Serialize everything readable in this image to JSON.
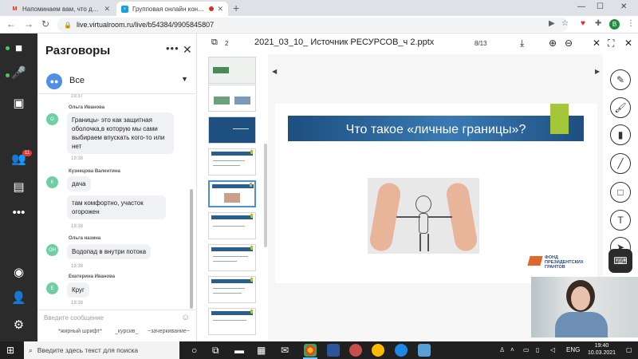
{
  "browser": {
    "tabs": [
      {
        "icon": "gmail-icon",
        "label": "Напоминаем вам, что до начал",
        "favicon_color": "#d93025"
      },
      {
        "icon": "virtualroom-icon",
        "label": "Групповая онлайн консульт",
        "favicon_color": "#1a9dd9",
        "recording": true
      }
    ],
    "url": "live.virtualroom.ru/live/b54384/9905845807",
    "profile_initial": "В"
  },
  "rail": {
    "items": [
      {
        "icon": "camera-icon"
      },
      {
        "icon": "microphone-icon"
      },
      {
        "icon": "contacts-icon"
      },
      {
        "icon": "participants-icon",
        "badge": "11"
      },
      {
        "icon": "chat-icon"
      },
      {
        "icon": "more-icon"
      },
      {
        "icon": "record-icon"
      },
      {
        "icon": "add-user-icon"
      },
      {
        "icon": "settings-icon"
      }
    ]
  },
  "chat": {
    "title": "Разговоры",
    "filter": "Все",
    "first_time": "19:37",
    "messages": [
      {
        "sender": "Ольга Иванова",
        "initials": "О",
        "text": "Границы- это как защитная оболочка,в которую мы сами выбираем впускать кого-то или нет",
        "time": "19:38"
      },
      {
        "sender": "Кузнецова Валентина",
        "initials": "К",
        "text": "дача",
        "time": ""
      },
      {
        "sender": "",
        "initials": "",
        "text": "там комфортно, участок огорожен",
        "time": "19:38"
      },
      {
        "sender": "Ольга назина",
        "initials": "ОН",
        "text": "Водопад в внутри потока",
        "time": "19:38"
      },
      {
        "sender": "Екатерина Иванова",
        "initials": "Е",
        "text": "Круг",
        "time": "19:38"
      }
    ],
    "composer_placeholder": "Введите сообщение",
    "format_bold": "*жирный шрифт*",
    "format_italic": "_курсив_",
    "format_strike": "~зачеркивание~"
  },
  "presentation": {
    "slide_count_icon": "2",
    "filename": "2021_03_10_ Источник РЕСУРСОВ_ч 2.pptx",
    "page": "8/13",
    "slide_title": "Что такое «личные границы»?",
    "logo_lines": [
      "ФОНД",
      "ПРЕЗИДЕНТСКИХ",
      "ГРАНТОВ"
    ]
  },
  "colors": {
    "rail_bg": "#2b2b2b",
    "slide_band": "#1d4f80",
    "slide_accent": "#a4c639",
    "mic_on": "#3fd15d",
    "badge": "#e53935"
  },
  "taskbar": {
    "search_placeholder": "Введите здесь текст для поиска",
    "language": "ENG",
    "time": "19:40",
    "date": "10.03.2021"
  }
}
